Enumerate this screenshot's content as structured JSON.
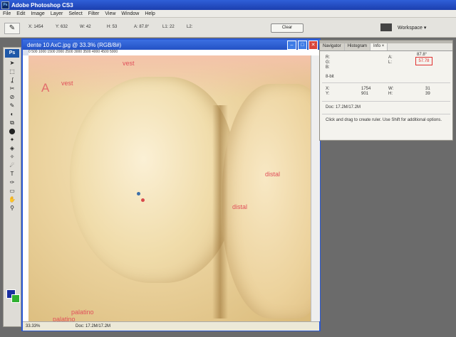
{
  "app": {
    "title": "Adobe Photoshop CS3"
  },
  "menu": [
    "File",
    "Edit",
    "Image",
    "Layer",
    "Select",
    "Filter",
    "View",
    "Window",
    "Help"
  ],
  "options": {
    "x_field": "X: 1454",
    "y_field": "Y: 632",
    "w_field": "W: 42",
    "h_field": "H: 53",
    "angle_field": "A: 87.8°",
    "l1_field": "L1: 22",
    "l2_field": "L2:",
    "clear_label": "Clear",
    "workspace_label": "Workspace ▾"
  },
  "tools": [
    "➤",
    "⬚",
    "ʆ",
    "✂",
    "⊘",
    "✎",
    "◐",
    "⧉",
    "⬤",
    "✦",
    "◈",
    "✧",
    "☄",
    "T",
    "✑",
    "▭",
    "✋",
    "⚲"
  ],
  "document": {
    "title": "dente 10 AxC.jpg @ 33.3% (RGB/8#)",
    "ruler": "0   500  1000  1500  2000  2500  3000  3500  4000  4500  5000",
    "labels": {
      "letter_a": "A",
      "vest_top": "vest",
      "vest_left": "vest",
      "distal_right": "distal",
      "distal_center": "distal",
      "palatino_1": "palatino",
      "palatino_2": "palatino"
    },
    "status_zoom": "33.33%",
    "status_doc": "Doc: 17.2M/17.2M"
  },
  "info_panel": {
    "tabs": [
      "Navigator",
      "Histogram",
      "Info ×"
    ],
    "r_label": "R:",
    "g_label": "G:",
    "b_label": "B:",
    "a_label": "A:",
    "a_value": "87.8°",
    "l_label": "L:",
    "l_value": "57.78",
    "depth_label": "8-bit",
    "x_label": "X:",
    "x_value": "1754",
    "y_label": "Y:",
    "y_value": "901",
    "w_label": "W:",
    "w_value": "31",
    "h_label": "H:",
    "h_value": "39",
    "doc_line": "Doc: 17.2M/17.2M",
    "hint": "Click and drag to create ruler. Use Shift for additional options."
  }
}
